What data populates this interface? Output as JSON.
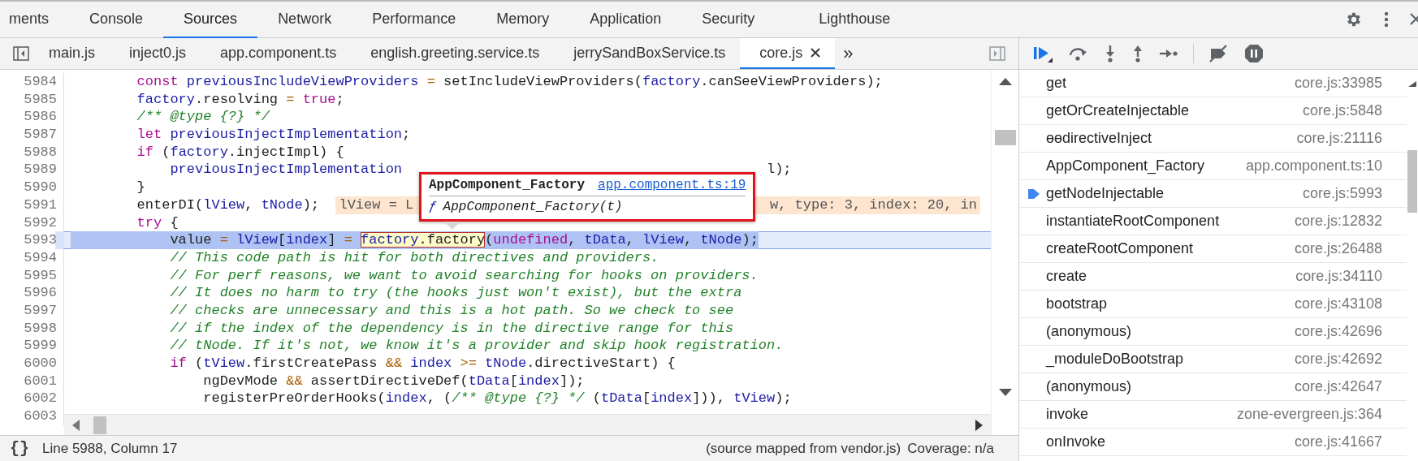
{
  "devtools_tabs": [
    {
      "label": "ments",
      "selected": false
    },
    {
      "label": "Console",
      "selected": false
    },
    {
      "label": "Sources",
      "selected": true
    },
    {
      "label": "Network",
      "selected": false
    },
    {
      "label": "Performance",
      "selected": false
    },
    {
      "label": "Memory",
      "selected": false
    },
    {
      "label": "Application",
      "selected": false
    },
    {
      "label": "Security",
      "selected": false
    },
    {
      "label": "Lighthouse",
      "selected": false
    }
  ],
  "file_tabs": [
    {
      "label": "main.js",
      "selected": false
    },
    {
      "label": "inject0.js",
      "selected": false
    },
    {
      "label": "app.component.ts",
      "selected": false
    },
    {
      "label": "english.greeting.service.ts",
      "selected": false
    },
    {
      "label": "jerrySandBoxService.ts",
      "selected": false
    },
    {
      "label": "core.js",
      "selected": true
    }
  ],
  "overflow_label": "»",
  "code": {
    "lines": [
      {
        "number": "5984",
        "paused": false,
        "tokens": [
          {
            "kind": "keyword",
            "text": "        const"
          },
          {
            "kind": "variable",
            "text": " previousIncludeViewProviders"
          },
          {
            "kind": "operator",
            "text": " ="
          },
          {
            "kind": "plain",
            "text": " setIncludeViewProviders("
          },
          {
            "kind": "variable",
            "text": "factory"
          },
          {
            "kind": "plain",
            "text": ".canSeeViewProviders);"
          }
        ]
      },
      {
        "number": "5985",
        "paused": false,
        "tokens": [
          {
            "kind": "variable",
            "text": "        factory"
          },
          {
            "kind": "plain",
            "text": ".resolving "
          },
          {
            "kind": "operator",
            "text": "="
          },
          {
            "kind": "keyword",
            "text": " true"
          },
          {
            "kind": "plain",
            "text": ";"
          }
        ]
      },
      {
        "number": "5986",
        "paused": false,
        "tokens": [
          {
            "kind": "comment",
            "text": "        /** @type {?} */"
          }
        ]
      },
      {
        "number": "5987",
        "paused": false,
        "tokens": [
          {
            "kind": "keyword",
            "text": "        let"
          },
          {
            "kind": "variable",
            "text": " previousInjectImplementation"
          },
          {
            "kind": "plain",
            "text": ";"
          }
        ]
      },
      {
        "number": "5988",
        "paused": false,
        "tokens": [
          {
            "kind": "keyword",
            "text": "        if"
          },
          {
            "kind": "plain",
            "text": " ("
          },
          {
            "kind": "variable",
            "text": "factory"
          },
          {
            "kind": "plain",
            "text": ".injectImpl) {"
          }
        ]
      },
      {
        "number": "5989",
        "paused": false,
        "tokens": [
          {
            "kind": "variable",
            "text": "            previousInjectImplementation"
          },
          {
            "kind": "gap"
          },
          {
            "kind": "plain",
            "text": "l);"
          }
        ]
      },
      {
        "number": "5990",
        "paused": false,
        "tokens": [
          {
            "kind": "plain",
            "text": "        }"
          }
        ]
      },
      {
        "number": "5991",
        "paused": false,
        "tokens": [
          {
            "kind": "plain",
            "text": "        enterDI("
          },
          {
            "kind": "variable",
            "text": "lView"
          },
          {
            "kind": "plain",
            "text": ", "
          },
          {
            "kind": "variable",
            "text": "tNode"
          },
          {
            "kind": "plain",
            "text": ");"
          }
        ],
        "inline_value": {
          "parts": [
            "lView = L",
            "w, type: 3, index: 20, in"
          ]
        }
      },
      {
        "number": "5992",
        "paused": false,
        "tokens": [
          {
            "kind": "keyword",
            "text": "        try"
          },
          {
            "kind": "plain",
            "text": " {"
          }
        ]
      },
      {
        "number": "5993",
        "paused": true,
        "tokens": [
          {
            "kind": "plain",
            "text": "            value "
          },
          {
            "kind": "operator",
            "text": "="
          },
          {
            "kind": "variable",
            "text": " lView"
          },
          {
            "kind": "plain",
            "text": "["
          },
          {
            "kind": "variable",
            "text": "index"
          },
          {
            "kind": "plain",
            "text": "] "
          },
          {
            "kind": "operator",
            "text": "= "
          },
          {
            "kind": "hover",
            "tokens": [
              {
                "kind": "variable",
                "text": "factory"
              },
              {
                "kind": "plain",
                "text": ".factory"
              }
            ]
          },
          {
            "kind": "plain",
            "text": "("
          },
          {
            "kind": "keyword",
            "text": "undefined"
          },
          {
            "kind": "plain",
            "text": ", "
          },
          {
            "kind": "variable",
            "text": "tData"
          },
          {
            "kind": "plain",
            "text": ", "
          },
          {
            "kind": "variable",
            "text": "lView"
          },
          {
            "kind": "plain",
            "text": ", "
          },
          {
            "kind": "variable",
            "text": "tNode"
          },
          {
            "kind": "plain",
            "text": ");"
          }
        ]
      },
      {
        "number": "5994",
        "paused": false,
        "tokens": [
          {
            "kind": "comment",
            "text": "            // This code path is hit for both directives and providers."
          }
        ]
      },
      {
        "number": "5995",
        "paused": false,
        "tokens": [
          {
            "kind": "comment",
            "text": "            // For perf reasons, we want to avoid searching for hooks on providers."
          }
        ]
      },
      {
        "number": "5996",
        "paused": false,
        "tokens": [
          {
            "kind": "comment",
            "text": "            // It does no harm to try (the hooks just won't exist), but the extra"
          }
        ]
      },
      {
        "number": "5997",
        "paused": false,
        "tokens": [
          {
            "kind": "comment",
            "text": "            // checks are unnecessary and this is a hot path. So we check to see"
          }
        ]
      },
      {
        "number": "5998",
        "paused": false,
        "tokens": [
          {
            "kind": "comment",
            "text": "            // if the index of the dependency is in the directive range for this"
          }
        ]
      },
      {
        "number": "5999",
        "paused": false,
        "tokens": [
          {
            "kind": "comment",
            "text": "            // tNode. If it's not, we know it's a provider and skip hook registration."
          }
        ]
      },
      {
        "number": "6000",
        "paused": false,
        "tokens": [
          {
            "kind": "keyword",
            "text": "            if"
          },
          {
            "kind": "plain",
            "text": " ("
          },
          {
            "kind": "variable",
            "text": "tView"
          },
          {
            "kind": "plain",
            "text": ".firstCreatePass "
          },
          {
            "kind": "operator",
            "text": "&&"
          },
          {
            "kind": "variable",
            "text": " index"
          },
          {
            "kind": "operator",
            "text": " >="
          },
          {
            "kind": "variable",
            "text": " tNode"
          },
          {
            "kind": "plain",
            "text": ".directiveStart) {"
          }
        ]
      },
      {
        "number": "6001",
        "paused": false,
        "tokens": [
          {
            "kind": "plain",
            "text": "                ngDevMode "
          },
          {
            "kind": "operator",
            "text": "&&"
          },
          {
            "kind": "plain",
            "text": " assertDirectiveDef("
          },
          {
            "kind": "variable",
            "text": "tData"
          },
          {
            "kind": "plain",
            "text": "["
          },
          {
            "kind": "variable",
            "text": "index"
          },
          {
            "kind": "plain",
            "text": "]);"
          }
        ]
      },
      {
        "number": "6002",
        "paused": false,
        "tokens": [
          {
            "kind": "plain",
            "text": "                registerPreOrderHooks("
          },
          {
            "kind": "variable",
            "text": "index"
          },
          {
            "kind": "plain",
            "text": ", ("
          },
          {
            "kind": "comment",
            "text": "/** @type {?} */"
          },
          {
            "kind": "plain",
            "text": " ("
          },
          {
            "kind": "variable",
            "text": "tData"
          },
          {
            "kind": "plain",
            "text": "["
          },
          {
            "kind": "variable",
            "text": "index"
          },
          {
            "kind": "plain",
            "text": "])), "
          },
          {
            "kind": "variable",
            "text": "tView"
          },
          {
            "kind": "plain",
            "text": ");"
          }
        ]
      },
      {
        "number": "6003",
        "paused": false
      }
    ],
    "tooltip": {
      "name": "AppComponent_Factory",
      "link": "app.component.ts:19",
      "signature_mark": "ƒ",
      "signature": "AppComponent_Factory(t)"
    }
  },
  "call_stack": [
    {
      "name": "get",
      "location": "core.js:33985",
      "current": false
    },
    {
      "name": "getOrCreateInjectable",
      "location": "core.js:5848",
      "current": false
    },
    {
      "name": "ɵɵdirectiveInject",
      "location": "core.js:21116",
      "current": false
    },
    {
      "name": "AppComponent_Factory",
      "location": "app.component.ts:10",
      "current": false
    },
    {
      "name": "getNodeInjectable",
      "location": "core.js:5993",
      "current": true
    },
    {
      "name": "instantiateRootComponent",
      "location": "core.js:12832",
      "current": false
    },
    {
      "name": "createRootComponent",
      "location": "core.js:26488",
      "current": false
    },
    {
      "name": "create",
      "location": "core.js:34110",
      "current": false
    },
    {
      "name": "bootstrap",
      "location": "core.js:43108",
      "current": false
    },
    {
      "name": "(anonymous)",
      "location": "core.js:42696",
      "current": false
    },
    {
      "name": "_moduleDoBootstrap",
      "location": "core.js:42692",
      "current": false
    },
    {
      "name": "(anonymous)",
      "location": "core.js:42647",
      "current": false
    },
    {
      "name": "invoke",
      "location": "zone-evergreen.js:364",
      "current": false
    },
    {
      "name": "onInvoke",
      "location": "core.js:41667",
      "current": false
    }
  ],
  "status_bar": {
    "pretty_print": "{}",
    "position": "Line 5988, Column 17",
    "source_map": "(source mapped from vendor.js)",
    "coverage": "Coverage: n/a"
  }
}
